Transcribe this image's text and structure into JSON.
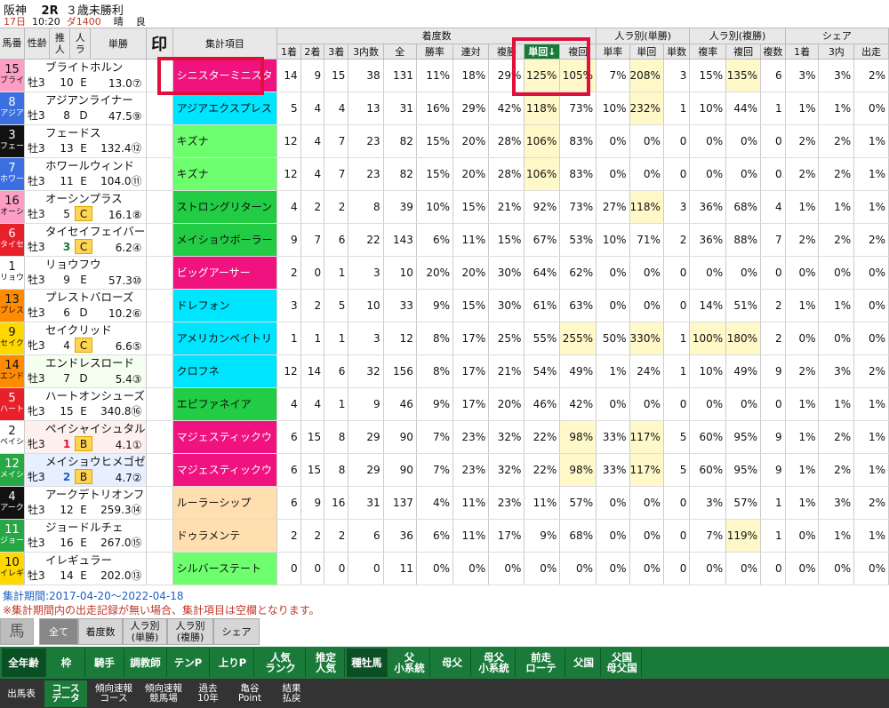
{
  "race": {
    "venue": "阪神",
    "race_no": "2R",
    "race_name": "３歳未勝利",
    "day": "17日",
    "time": "10:20",
    "course": "ダ1400",
    "weather": "晴",
    "going": "良"
  },
  "headers": {
    "uma": "馬番",
    "seirei": "性齢",
    "suitei": "推人",
    "ninki": "人ラ",
    "tansho": "単勝",
    "shirushi": "印",
    "item": "集計項目",
    "group_chaku": "着度数",
    "group_ninki_tan": "人ラ別(単勝)",
    "group_ninki_fuku": "人ラ別(複勝)",
    "group_share": "シェア",
    "c1": "1着",
    "c2": "2着",
    "c3": "3着",
    "c3n": "3内数",
    "all": "全",
    "win": "勝率",
    "ren": "連対",
    "fuku": "複勝",
    "tankai": "単回↓",
    "fukukai": "複回",
    "nt_rate": "単率",
    "nt_kai": "単回",
    "nt_count": "単数",
    "nf_rate": "複率",
    "nf_kai": "複回",
    "nf_count": "複数",
    "s1": "1着",
    "s3": "3内",
    "sd": "出走"
  },
  "colors": {
    "red_box": "#e0103a",
    "highlight": "#fff8c8"
  },
  "rows": [
    {
      "no": "15",
      "abbr": "ブライ",
      "pin": "",
      "name": "ブライトホルン",
      "sex": "牡3",
      "age": "10",
      "letter": "E",
      "suitei": "",
      "odds": "13.0⑦",
      "ban_color": "#ff9ec4",
      "ban_text": "#111",
      "item": "シニスターミニスタ",
      "item_color": "#f0127f",
      "item_text": "#fff",
      "c1": "14",
      "c2": "9",
      "c3": "15",
      "c3n": "38",
      "all": "131",
      "win": "11%",
      "ren": "18%",
      "fuku": "29%",
      "tankai": "125%",
      "fukukai": "105%",
      "nt_rate": "7%",
      "nt_kai": "208%",
      "nt_count": "3",
      "nf_rate": "15%",
      "nf_kai": "135%",
      "nf_count": "6",
      "s1": "3%",
      "s3": "3%",
      "sd": "2%",
      "hl": [
        "tankai",
        "fukukai",
        "nt_kai",
        "nf_kai"
      ]
    },
    {
      "no": "8",
      "abbr": "アジア",
      "pin": "",
      "name": "アジアンライナー",
      "sex": "牡3",
      "age": "8",
      "letter": "D",
      "suitei": "",
      "odds": "47.5⑨",
      "ban_color": "#3b6fe0",
      "ban_text": "#fff",
      "item": "アジアエクスプレス",
      "item_color": "#00e5ff",
      "item_text": "#111",
      "c1": "5",
      "c2": "4",
      "c3": "4",
      "c3n": "13",
      "all": "31",
      "win": "16%",
      "ren": "29%",
      "fuku": "42%",
      "tankai": "118%",
      "fukukai": "73%",
      "nt_rate": "10%",
      "nt_kai": "232%",
      "nt_count": "1",
      "nf_rate": "10%",
      "nf_kai": "44%",
      "nf_count": "1",
      "s1": "1%",
      "s3": "1%",
      "sd": "0%",
      "hl": [
        "tankai",
        "nt_kai"
      ]
    },
    {
      "no": "3",
      "abbr": "フェー",
      "pin": "",
      "name": "フェードス",
      "sex": "牡3",
      "age": "13",
      "letter": "E",
      "suitei": "",
      "odds": "132.4⑫",
      "ban_color": "#111",
      "ban_text": "#fff",
      "item": "キズナ",
      "item_color": "#6dff6d",
      "item_text": "#111",
      "c1": "12",
      "c2": "4",
      "c3": "7",
      "c3n": "23",
      "all": "82",
      "win": "15%",
      "ren": "20%",
      "fuku": "28%",
      "tankai": "106%",
      "fukukai": "83%",
      "nt_rate": "0%",
      "nt_kai": "0%",
      "nt_count": "0",
      "nf_rate": "0%",
      "nf_kai": "0%",
      "nf_count": "0",
      "s1": "2%",
      "s3": "2%",
      "sd": "1%",
      "hl": [
        "tankai"
      ]
    },
    {
      "no": "7",
      "abbr": "ホワー",
      "pin": "",
      "name": "ホワールウィンド",
      "sex": "牡3",
      "age": "11",
      "letter": "E",
      "suitei": "",
      "odds": "104.0⑪",
      "ban_color": "#3b6fe0",
      "ban_text": "#fff",
      "item": "キズナ",
      "item_color": "#6dff6d",
      "item_text": "#111",
      "c1": "12",
      "c2": "4",
      "c3": "7",
      "c3n": "23",
      "all": "82",
      "win": "15%",
      "ren": "20%",
      "fuku": "28%",
      "tankai": "106%",
      "fukukai": "83%",
      "nt_rate": "0%",
      "nt_kai": "0%",
      "nt_count": "0",
      "nf_rate": "0%",
      "nf_kai": "0%",
      "nf_count": "0",
      "s1": "2%",
      "s3": "2%",
      "sd": "1%",
      "hl": [
        "tankai"
      ]
    },
    {
      "no": "16",
      "abbr": "オーシ",
      "pin": "",
      "name": "オーシンプラス",
      "sex": "牡3",
      "age": "5",
      "letter": "C",
      "suitei": "",
      "odds": "16.1⑧",
      "ban_color": "#ff9ec4",
      "ban_text": "#111",
      "item": "ストロングリターン",
      "item_color": "#22cc44",
      "item_text": "#111",
      "c1": "4",
      "c2": "2",
      "c3": "2",
      "c3n": "8",
      "all": "39",
      "win": "10%",
      "ren": "15%",
      "fuku": "21%",
      "tankai": "92%",
      "fukukai": "73%",
      "nt_rate": "27%",
      "nt_kai": "118%",
      "nt_count": "3",
      "nf_rate": "36%",
      "nf_kai": "68%",
      "nf_count": "4",
      "s1": "1%",
      "s3": "1%",
      "sd": "1%",
      "hl": [
        "nt_kai"
      ]
    },
    {
      "no": "6",
      "abbr": "タイセ",
      "pin": "",
      "name": "タイセイフェイバー",
      "sex": "牡3",
      "age": "3",
      "letter": "C",
      "suitei": "3",
      "odds": "6.2④",
      "ban_color": "#e8202a",
      "ban_text": "#fff",
      "item": "メイショウボーラー",
      "item_color": "#22cc44",
      "item_text": "#111",
      "c1": "9",
      "c2": "7",
      "c3": "6",
      "c3n": "22",
      "all": "143",
      "win": "6%",
      "ren": "11%",
      "fuku": "15%",
      "tankai": "67%",
      "fukukai": "53%",
      "nt_rate": "10%",
      "nt_kai": "71%",
      "nt_count": "2",
      "nf_rate": "36%",
      "nf_kai": "88%",
      "nf_count": "7",
      "s1": "2%",
      "s3": "2%",
      "sd": "2%",
      "hl": []
    },
    {
      "no": "1",
      "abbr": "リョウ",
      "pin": "",
      "name": "リョウフウ",
      "sex": "牡3",
      "age": "9",
      "letter": "E",
      "suitei": "",
      "odds": "57.3⑩",
      "ban_color": "#ffffff",
      "ban_text": "#111",
      "item": "ビッグアーサー",
      "item_color": "#f0127f",
      "item_text": "#fff",
      "c1": "2",
      "c2": "0",
      "c3": "1",
      "c3n": "3",
      "all": "10",
      "win": "20%",
      "ren": "20%",
      "fuku": "30%",
      "tankai": "64%",
      "fukukai": "62%",
      "nt_rate": "0%",
      "nt_kai": "0%",
      "nt_count": "0",
      "nf_rate": "0%",
      "nf_kai": "0%",
      "nf_count": "0",
      "s1": "0%",
      "s3": "0%",
      "sd": "0%",
      "hl": []
    },
    {
      "no": "13",
      "abbr": "プレス",
      "pin": "",
      "name": "プレストバローズ",
      "sex": "牡3",
      "age": "6",
      "letter": "D",
      "suitei": "",
      "odds": "10.2⑥",
      "ban_color": "#ff8c00",
      "ban_text": "#111",
      "item": "ドレフォン",
      "item_color": "#00e5ff",
      "item_text": "#111",
      "c1": "3",
      "c2": "2",
      "c3": "5",
      "c3n": "10",
      "all": "33",
      "win": "9%",
      "ren": "15%",
      "fuku": "30%",
      "tankai": "61%",
      "fukukai": "63%",
      "nt_rate": "0%",
      "nt_kai": "0%",
      "nt_count": "0",
      "nf_rate": "14%",
      "nf_kai": "51%",
      "nf_count": "2",
      "s1": "1%",
      "s3": "1%",
      "sd": "0%",
      "hl": []
    },
    {
      "no": "9",
      "abbr": "セイク",
      "pin": "",
      "name": "セイクリッド",
      "sex": "牝3",
      "age": "4",
      "letter": "C",
      "suitei": "",
      "odds": "6.6⑤",
      "ban_color": "#ffd800",
      "ban_text": "#111",
      "item": "アメリカンペイトリ",
      "item_color": "#00e5ff",
      "item_text": "#111",
      "c1": "1",
      "c2": "1",
      "c3": "1",
      "c3n": "3",
      "all": "12",
      "win": "8%",
      "ren": "17%",
      "fuku": "25%",
      "tankai": "55%",
      "fukukai": "255%",
      "nt_rate": "50%",
      "nt_kai": "330%",
      "nt_count": "1",
      "nf_rate": "100%",
      "nf_kai": "180%",
      "nf_count": "2",
      "s1": "0%",
      "s3": "0%",
      "sd": "0%",
      "hl": [
        "fukukai",
        "nt_kai",
        "nf_rate",
        "nf_kai"
      ]
    },
    {
      "no": "14",
      "abbr": "エンド",
      "pin": "",
      "name": "エンドレスロード",
      "sex": "牡3",
      "age": "7",
      "letter": "D",
      "suitei": "",
      "odds": "5.4③",
      "ban_color": "#ff8c00",
      "ban_text": "#111",
      "item": "クロフネ",
      "item_color": "#00e5ff",
      "item_text": "#111",
      "c1": "12",
      "c2": "14",
      "c3": "6",
      "c3n": "32",
      "all": "156",
      "win": "8%",
      "ren": "17%",
      "fuku": "21%",
      "tankai": "54%",
      "fukukai": "49%",
      "nt_rate": "1%",
      "nt_kai": "24%",
      "nt_count": "1",
      "nf_rate": "10%",
      "nf_kai": "49%",
      "nf_count": "9",
      "s1": "2%",
      "s3": "3%",
      "sd": "2%",
      "hl": []
    },
    {
      "no": "5",
      "abbr": "ハート",
      "pin": "",
      "name": "ハートオンシューズ",
      "sex": "牝3",
      "age": "15",
      "letter": "E",
      "suitei": "",
      "odds": "340.8⑯",
      "ban_color": "#e8202a",
      "ban_text": "#fff",
      "item": "エピファネイア",
      "item_color": "#22cc44",
      "item_text": "#111",
      "c1": "4",
      "c2": "4",
      "c3": "1",
      "c3n": "9",
      "all": "46",
      "win": "9%",
      "ren": "17%",
      "fuku": "20%",
      "tankai": "46%",
      "fukukai": "42%",
      "nt_rate": "0%",
      "nt_kai": "0%",
      "nt_count": "0",
      "nf_rate": "0%",
      "nf_kai": "0%",
      "nf_count": "0",
      "s1": "1%",
      "s3": "1%",
      "sd": "1%",
      "hl": []
    },
    {
      "no": "2",
      "abbr": "ペイシ",
      "pin": "",
      "name": "ペイシャイシュタル",
      "sex": "牝3",
      "age": "1",
      "letter": "B",
      "suitei": "1",
      "odds": "4.1①",
      "ban_color": "#ffffff",
      "ban_text": "#111",
      "item": "マジェスティックウ",
      "item_color": "#f0127f",
      "item_text": "#fff",
      "c1": "6",
      "c2": "15",
      "c3": "8",
      "c3n": "29",
      "all": "90",
      "win": "7%",
      "ren": "23%",
      "fuku": "32%",
      "tankai": "22%",
      "fukukai": "98%",
      "nt_rate": "33%",
      "nt_kai": "117%",
      "nt_count": "5",
      "nf_rate": "60%",
      "nf_kai": "95%",
      "nf_count": "9",
      "s1": "1%",
      "s3": "2%",
      "sd": "1%",
      "hl": [
        "fukukai",
        "nt_kai"
      ]
    },
    {
      "no": "12",
      "abbr": "メイシ",
      "pin": "",
      "name": "メイショウヒメゴゼ",
      "sex": "牝3",
      "age": "2",
      "letter": "B",
      "suitei": "2",
      "odds": "4.7②",
      "ban_color": "#28a745",
      "ban_text": "#fff",
      "item": "マジェスティックウ",
      "item_color": "#f0127f",
      "item_text": "#fff",
      "c1": "6",
      "c2": "15",
      "c3": "8",
      "c3n": "29",
      "all": "90",
      "win": "7%",
      "ren": "23%",
      "fuku": "32%",
      "tankai": "22%",
      "fukukai": "98%",
      "nt_rate": "33%",
      "nt_kai": "117%",
      "nt_count": "5",
      "nf_rate": "60%",
      "nf_kai": "95%",
      "nf_count": "9",
      "s1": "1%",
      "s3": "2%",
      "sd": "1%",
      "hl": [
        "fukukai",
        "nt_kai"
      ]
    },
    {
      "no": "4",
      "abbr": "アーク",
      "pin": "",
      "name": "アークデトリオンフ",
      "sex": "牡3",
      "age": "12",
      "letter": "E",
      "suitei": "",
      "odds": "259.3⑭",
      "ban_color": "#111",
      "ban_text": "#fff",
      "item": "ルーラーシップ",
      "item_color": "#ffdfb0",
      "item_text": "#111",
      "c1": "6",
      "c2": "9",
      "c3": "16",
      "c3n": "31",
      "all": "137",
      "win": "4%",
      "ren": "11%",
      "fuku": "23%",
      "tankai": "11%",
      "fukukai": "57%",
      "nt_rate": "0%",
      "nt_kai": "0%",
      "nt_count": "0",
      "nf_rate": "3%",
      "nf_kai": "57%",
      "nf_count": "1",
      "s1": "1%",
      "s3": "3%",
      "sd": "2%",
      "hl": []
    },
    {
      "no": "11",
      "abbr": "ジョー",
      "pin": "",
      "name": "ジョードルチェ",
      "sex": "牡3",
      "age": "16",
      "letter": "E",
      "suitei": "",
      "odds": "267.0⑮",
      "ban_color": "#28a745",
      "ban_text": "#fff",
      "item": "ドゥラメンテ",
      "item_color": "#ffdfb0",
      "item_text": "#111",
      "c1": "2",
      "c2": "2",
      "c3": "2",
      "c3n": "6",
      "all": "36",
      "win": "6%",
      "ren": "11%",
      "fuku": "17%",
      "tankai": "9%",
      "fukukai": "68%",
      "nt_rate": "0%",
      "nt_kai": "0%",
      "nt_count": "0",
      "nf_rate": "7%",
      "nf_kai": "119%",
      "nf_count": "1",
      "s1": "0%",
      "s3": "1%",
      "sd": "1%",
      "hl": [
        "nf_kai"
      ]
    },
    {
      "no": "10",
      "abbr": "イレギ",
      "pin": "",
      "name": "イレギュラー",
      "sex": "牡3",
      "age": "14",
      "letter": "E",
      "suitei": "",
      "odds": "202.0⑬",
      "ban_color": "#ffd800",
      "ban_text": "#111",
      "item": "シルバーステート",
      "item_color": "#6dff6d",
      "item_text": "#111",
      "c1": "0",
      "c2": "0",
      "c3": "0",
      "c3n": "0",
      "all": "11",
      "win": "0%",
      "ren": "0%",
      "fuku": "0%",
      "tankai": "0%",
      "fukukai": "0%",
      "nt_rate": "0%",
      "nt_kai": "0%",
      "nt_count": "0",
      "nf_rate": "0%",
      "nf_kai": "0%",
      "nf_count": "0",
      "s1": "0%",
      "s3": "0%",
      "sd": "0%",
      "hl": []
    }
  ],
  "notes": {
    "period": "集計期間:2017-04-20～2022-04-18",
    "blank": "※集計期間内の出走記録が無い場合、集計項目は空欄となります。"
  },
  "tabs1": [
    {
      "label": "馬"
    },
    {
      "label": "全て"
    },
    {
      "label": "着度数"
    },
    {
      "label": "人ラ別\n(単勝)"
    },
    {
      "label": "人ラ別\n(複勝)"
    },
    {
      "label": "シェア"
    }
  ],
  "tabs2": [
    {
      "label": "全年齢"
    },
    {
      "label": "枠"
    },
    {
      "label": "騎手"
    },
    {
      "label": "調教師"
    },
    {
      "label": "テンP"
    },
    {
      "label": "上りP"
    },
    {
      "label": "人気\nランク"
    },
    {
      "label": "推定\n人気"
    },
    {
      "label": "種牡馬"
    },
    {
      "label": "父\n小系統"
    },
    {
      "label": "母父"
    },
    {
      "label": "母父\n小系統"
    },
    {
      "label": "前走\nローテ"
    },
    {
      "label": "父国"
    },
    {
      "label": "父国\n母父国"
    }
  ],
  "tabs3": [
    {
      "label": "出馬表"
    },
    {
      "label": "コース\nデータ"
    },
    {
      "label": "傾向速報\nコース"
    },
    {
      "label": "傾向速報\n競馬場"
    },
    {
      "label": "過去\n10年"
    },
    {
      "label": "亀谷\nPoint"
    },
    {
      "label": "結果\n払戻"
    }
  ]
}
